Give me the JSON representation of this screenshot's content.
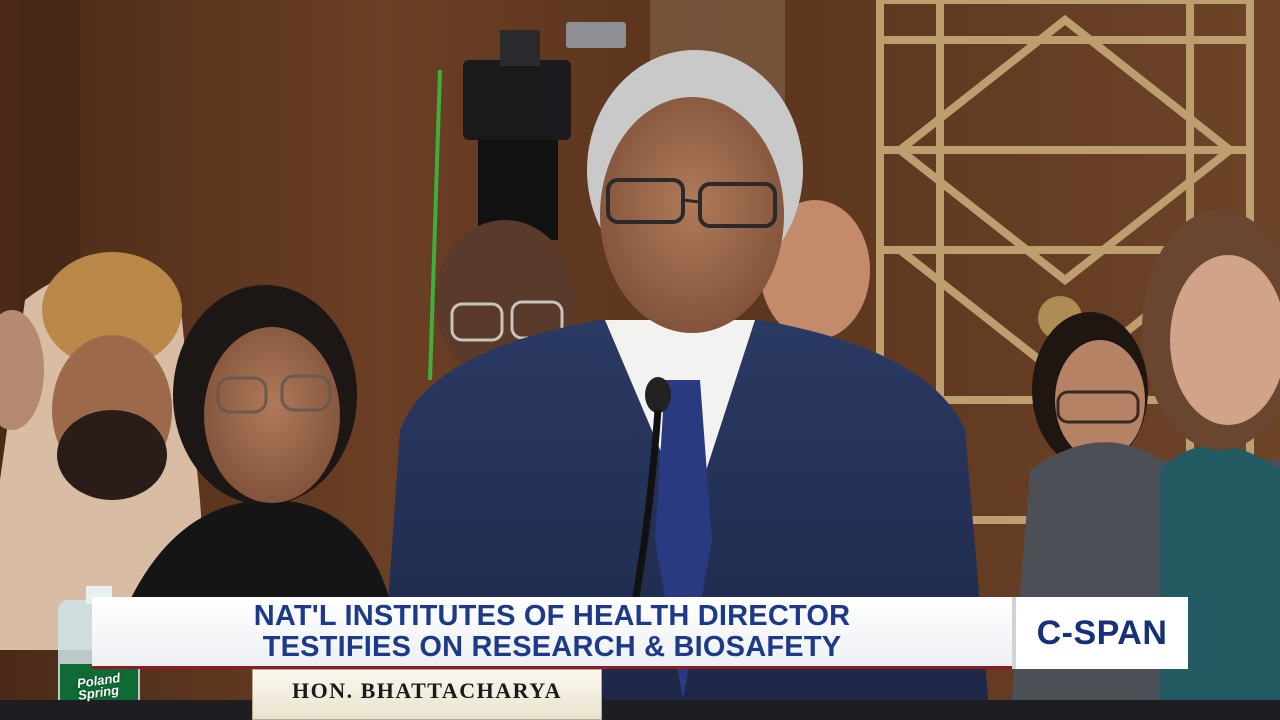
{
  "broadcast": {
    "headline_line1": "NAT'L INSTITUTES OF HEALTH DIRECTOR",
    "headline_line2": "TESTIFIES ON RESEARCH & BIOSAFETY",
    "network_logo": "C-SPAN"
  },
  "nameplate": {
    "text": "HON. BHATTACHARYA"
  },
  "water_bottle": {
    "brand_line1": "Poland",
    "brand_line2": "Spring"
  },
  "colors": {
    "headline_text": "#1d3a8a",
    "headline_accent": "#8c1d24",
    "network_logo": "#16307a",
    "wood_panel": "#6b3f24"
  }
}
